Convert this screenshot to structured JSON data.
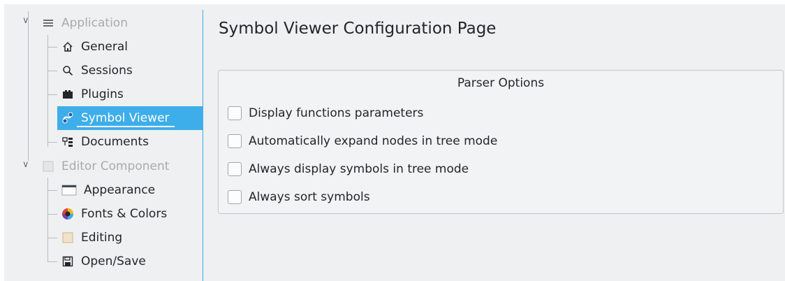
{
  "sidebar": {
    "application_group": {
      "label": "Application",
      "icon": "hamburger-menu-icon"
    },
    "application_items": [
      {
        "label": "General",
        "icon": "home-icon"
      },
      {
        "label": "Sessions",
        "icon": "search-icon"
      },
      {
        "label": "Plugins",
        "icon": "plugin-icon"
      },
      {
        "label": "Symbol Viewer",
        "icon": "symbol-viewer-icon",
        "selected": true
      },
      {
        "label": "Documents",
        "icon": "documents-tree-icon"
      }
    ],
    "editor_group": {
      "label": "Editor Component",
      "icon": "editor-icon"
    },
    "editor_items": [
      {
        "label": "Appearance",
        "icon": "window-icon"
      },
      {
        "label": "Fonts & Colors",
        "icon": "color-wheel-icon"
      },
      {
        "label": "Editing",
        "icon": "editing-icon"
      },
      {
        "label": "Open/Save",
        "icon": "floppy-disk-icon"
      }
    ]
  },
  "page": {
    "title": "Symbol Viewer Configuration Page",
    "groupbox": {
      "title": "Parser Options",
      "options": [
        {
          "label": "Display functions parameters",
          "checked": false
        },
        {
          "label": "Automatically expand nodes in tree mode",
          "checked": false
        },
        {
          "label": "Always display symbols in tree mode",
          "checked": false
        },
        {
          "label": "Always sort symbols",
          "checked": false
        }
      ]
    }
  },
  "colors": {
    "accent": "#3daee9",
    "window_bg": "#eff0f1",
    "text": "#232629",
    "disabled_text": "#a8abad"
  }
}
